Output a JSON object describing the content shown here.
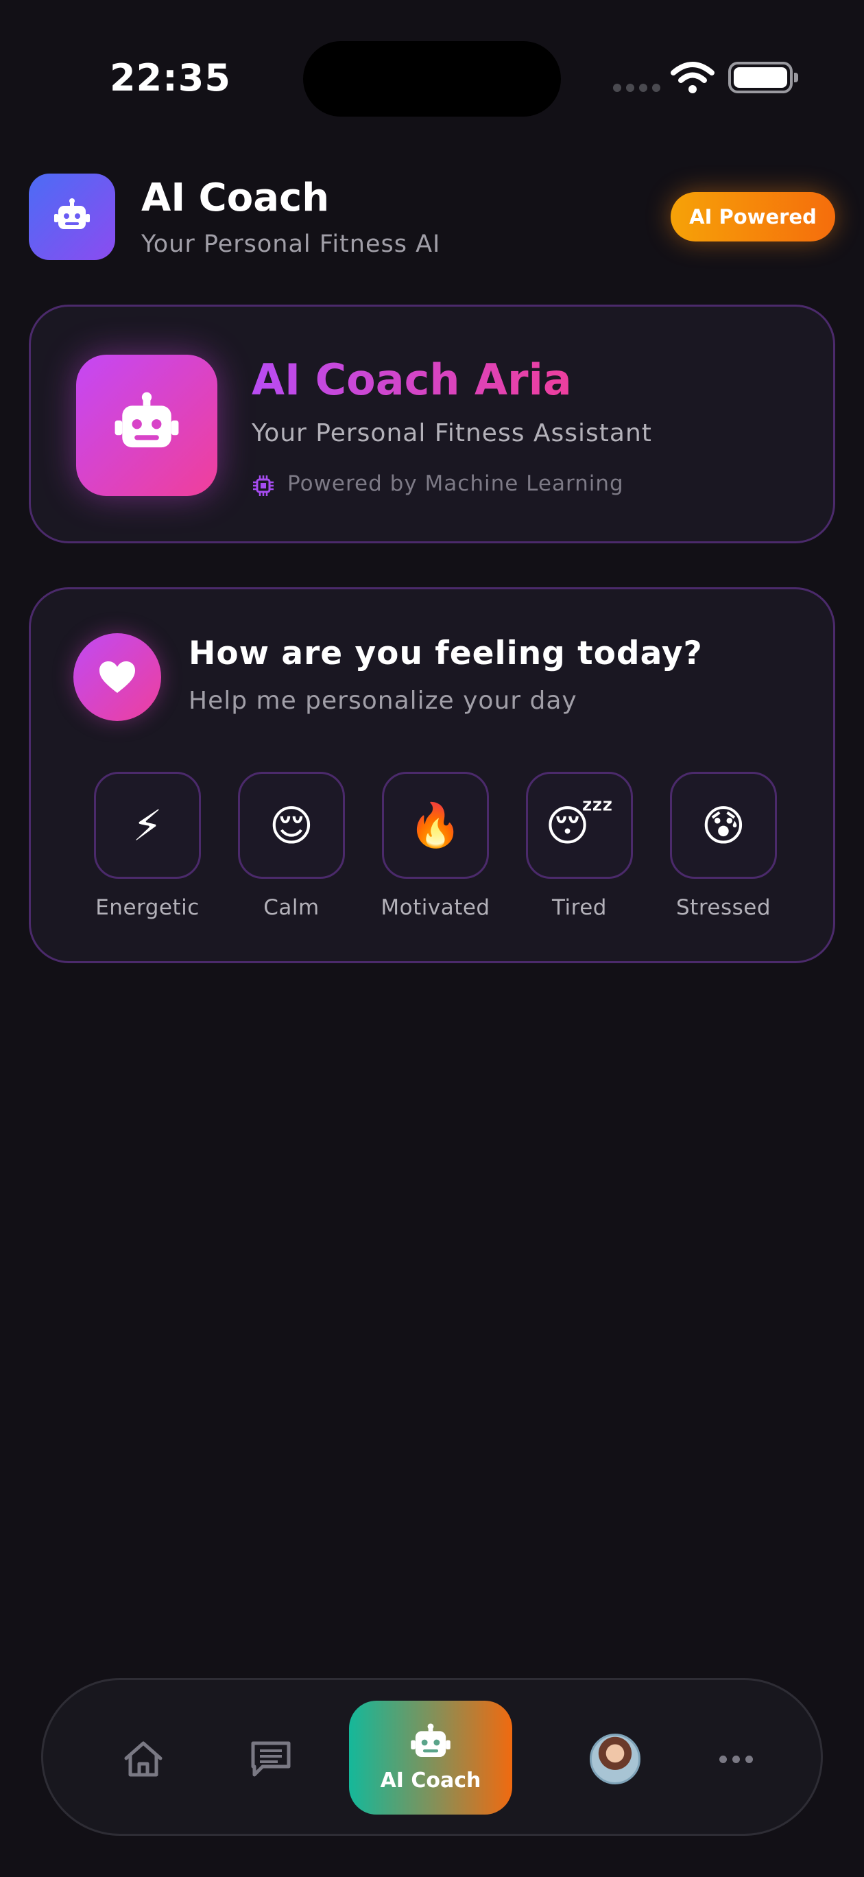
{
  "status_bar": {
    "time": "22:35"
  },
  "header": {
    "title": "AI Coach",
    "subtitle": "Your Personal Fitness AI",
    "badge": "AI Powered",
    "icon": "robot-icon"
  },
  "coach_card": {
    "name": "AI Coach Aria",
    "subtitle": "Your Personal Fitness Assistant",
    "powered_by": "Powered by Machine Learning",
    "avatar_icon": "robot-icon",
    "powered_icon": "chip-icon"
  },
  "mood": {
    "title": "How are you feeling today?",
    "subtitle": "Help me personalize your day",
    "icon": "heart-icon",
    "options": [
      {
        "emoji": "⚡",
        "label": "Energetic"
      },
      {
        "emoji": "😌",
        "label": "Calm"
      },
      {
        "emoji": "🔥",
        "label": "Motivated"
      },
      {
        "emoji": "😴",
        "label": "Tired"
      },
      {
        "emoji": "😰",
        "label": "Stressed"
      }
    ]
  },
  "bottom_nav": {
    "items": [
      "home-icon",
      "chat-icon",
      "robot-icon",
      "profile-avatar",
      "more-icon"
    ],
    "active_label": "AI Coach"
  },
  "colors": {
    "background": "#121016",
    "card": "#1a1722",
    "card_border": "#4b2a6b",
    "accent_purple": "#b84cf2",
    "accent_pink": "#ee3f9d",
    "badge_orange": "#f6a208",
    "nav_teal": "#15b89a",
    "nav_orange": "#f06a10"
  }
}
